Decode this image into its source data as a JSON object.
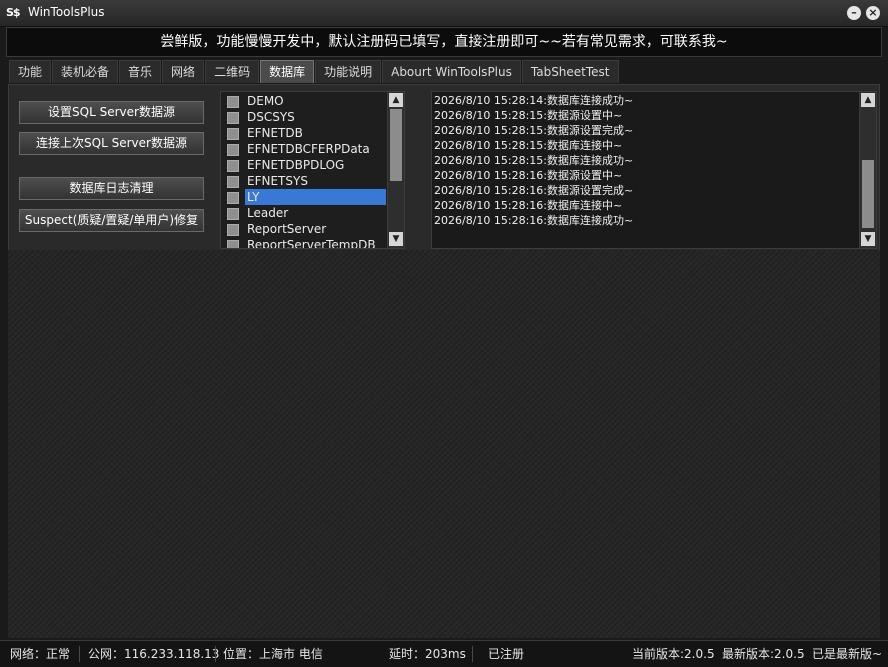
{
  "window": {
    "app_icon": "S$",
    "title": "WinToolsPlus",
    "minimize_label": "–",
    "close_label": "×"
  },
  "banner": "尝鲜版，功能慢慢开发中，默认注册码已填写，直接注册即可~~若有常见需求，可联系我~",
  "tabs": [
    {
      "label": "功能",
      "active": false
    },
    {
      "label": "装机必备",
      "active": false
    },
    {
      "label": "音乐",
      "active": false
    },
    {
      "label": "网络",
      "active": false
    },
    {
      "label": "二维码",
      "active": false
    },
    {
      "label": "数据库",
      "active": true
    },
    {
      "label": "功能说明",
      "active": false
    },
    {
      "label": "Abourt WinToolsPlus",
      "active": false
    },
    {
      "label": "TabSheetTest",
      "active": false
    }
  ],
  "buttons": {
    "set_source": "设置SQL Server数据源",
    "connect_last": "连接上次SQL Server数据源",
    "log_clean": "数据库日志清理",
    "suspect_fix": "Suspect(质疑/置疑/单用户)修复"
  },
  "databases": [
    {
      "name": "DEMO",
      "selected": false
    },
    {
      "name": "DSCSYS",
      "selected": false
    },
    {
      "name": "EFNETDB",
      "selected": false
    },
    {
      "name": "EFNETDBCFERPData",
      "selected": false
    },
    {
      "name": "EFNETDBPDLOG",
      "selected": false
    },
    {
      "name": "EFNETSYS",
      "selected": false
    },
    {
      "name": "LY",
      "selected": true
    },
    {
      "name": "Leader",
      "selected": false
    },
    {
      "name": "ReportServer",
      "selected": false
    },
    {
      "name": "ReportServerTempDB",
      "selected": false
    }
  ],
  "scroll": {
    "up_icon": "chevron-up-icon",
    "down_icon": "chevron-down-icon"
  },
  "log_lines": [
    "2026/8/10 15:28:14:数据库连接成功~",
    "2026/8/10 15:28:15:数据源设置中~",
    "2026/8/10 15:28:15:数据源设置完成~",
    "2026/8/10 15:28:15:数据库连接中~",
    "2026/8/10 15:28:15:数据库连接成功~",
    "2026/8/10 15:28:16:数据源设置中~",
    "2026/8/10 15:28:16:数据源设置完成~",
    "2026/8/10 15:28:16:数据库连接中~",
    "2026/8/10 15:28:16:数据库连接成功~"
  ],
  "status": {
    "network": "网络：正常",
    "public_ip": "公网：116.233.118.13",
    "location": "位置：上海市 电信",
    "latency": "延时：203ms",
    "registered": "已注册",
    "current_version": "当前版本:2.0.5",
    "latest_version": "最新版本:2.0.5",
    "is_latest": "已是最新版~"
  },
  "colors": {
    "selection": "#3a78d6",
    "background": "#1a1a1a"
  }
}
